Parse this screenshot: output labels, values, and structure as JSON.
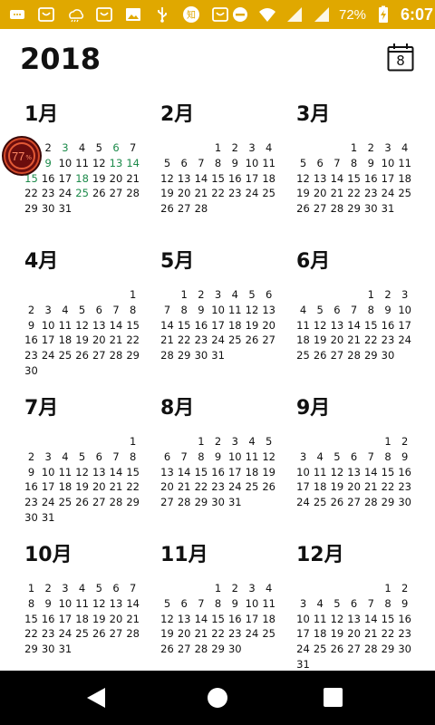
{
  "status_bar": {
    "battery_text": "72%",
    "time": "6:07",
    "background": "#e0a800",
    "icons": [
      "messages-icon",
      "shopping-bag-icon",
      "weather-icon",
      "shopping-bag-icon",
      "image-icon",
      "usb-icon",
      "zhihu-icon",
      "shopping-bag-icon",
      "dnd-icon",
      "wifi-icon",
      "signal-icon",
      "signal-icon",
      "battery-charging-icon"
    ]
  },
  "header": {
    "year": "2018",
    "today_day": "8"
  },
  "badge": {
    "value": "77",
    "unit": "%"
  },
  "highlight_color": "#1c8a4a",
  "months": [
    {
      "title": "1月",
      "start": 0,
      "days": 31
    },
    {
      "title": "2月",
      "start": 3,
      "days": 28
    },
    {
      "title": "3月",
      "start": 3,
      "days": 31
    },
    {
      "title": "4月",
      "start": 6,
      "days": 30
    },
    {
      "title": "5月",
      "start": 1,
      "days": 31
    },
    {
      "title": "6月",
      "start": 4,
      "days": 30
    },
    {
      "title": "7月",
      "start": 6,
      "days": 31
    },
    {
      "title": "8月",
      "start": 2,
      "days": 31
    },
    {
      "title": "9月",
      "start": 5,
      "days": 30
    },
    {
      "title": "10月",
      "start": 0,
      "days": 31
    },
    {
      "title": "11月",
      "start": 3,
      "days": 30
    },
    {
      "title": "12月",
      "start": 5,
      "days": 31
    }
  ],
  "green_days_january": [
    3,
    6,
    9,
    13,
    14,
    15,
    18,
    25
  ]
}
